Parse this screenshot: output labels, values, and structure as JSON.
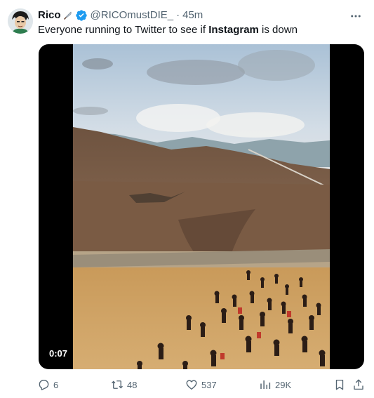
{
  "tweet": {
    "display_name": "Rico",
    "name_emoji_icon": "knife-icon",
    "verified_icon": "verified-badge-icon",
    "handle": "@RICOmustDIE_",
    "separator": "·",
    "time": "45m",
    "text_before": "Everyone running to Twitter to see if ",
    "text_bold": "Instagram",
    "text_after": " is down",
    "media": {
      "type": "video",
      "duration": "0:07"
    },
    "actions": {
      "replies": "6",
      "retweets": "48",
      "likes": "537",
      "views": "29K"
    }
  },
  "icons": {
    "more": "more-dots-icon",
    "reply": "reply-icon",
    "retweet": "retweet-icon",
    "like": "heart-icon",
    "views": "views-chart-icon",
    "bookmark": "bookmark-icon",
    "share": "share-icon"
  },
  "colors": {
    "text": "#0f1419",
    "secondary": "#536471",
    "verified": "#1d9bf0",
    "background": "#ffffff"
  }
}
